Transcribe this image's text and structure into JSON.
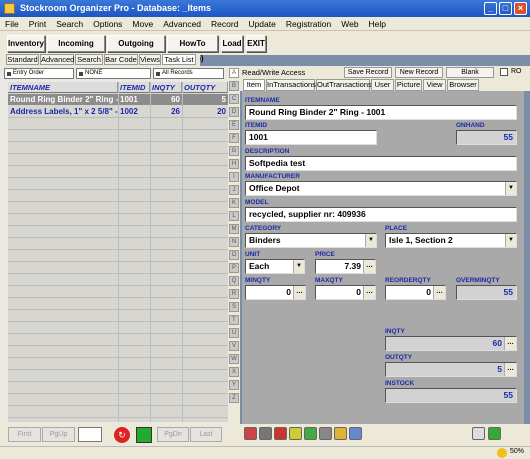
{
  "window": {
    "title": "Stockroom Organizer Pro - Database: _Items"
  },
  "menu": [
    "File",
    "Print",
    "Search",
    "Options",
    "Move",
    "Advanced",
    "Record",
    "Update",
    "Registration",
    "Web",
    "Help"
  ],
  "toolbar": {
    "inventory": "Inventory",
    "incoming": "Incoming Items",
    "outgoing": "Outgoing Items",
    "howto": "HowTo (Web)",
    "load": "Load",
    "exit": "EXIT"
  },
  "left_tabs": [
    "Standard",
    "Advanced",
    "Search",
    "Bar Code",
    "Views",
    "Task List"
  ],
  "filters": {
    "order": "Entry Order",
    "none": "NONE",
    "records": "All Records"
  },
  "grid": {
    "columns": [
      "ITEMNAME",
      "ITEMID",
      "INQTY",
      "OUTQTY"
    ],
    "rows": [
      {
        "name": "Round Ring Binder 2\" Ring - 1001",
        "id": "1001",
        "inqty": "60",
        "outqty": "5"
      },
      {
        "name": "Address Labels, 1\" x 2 5/8\" - 1002",
        "id": "1002",
        "inqty": "26",
        "outqty": "20"
      }
    ]
  },
  "alpha": [
    "A",
    "B",
    "C",
    "D",
    "E",
    "F",
    "G",
    "H",
    "I",
    "J",
    "K",
    "L",
    "M",
    "N",
    "O",
    "P",
    "Q",
    "R",
    "S",
    "T",
    "U",
    "V",
    "W",
    "X",
    "Y",
    "Z"
  ],
  "nav": {
    "first": "First",
    "pgup": "PgUp",
    "pgdn": "PgDn",
    "last": "Last"
  },
  "rw": {
    "label": "Read/Write Access",
    "save": "Save Record",
    "new": "New Record",
    "blank": "Blank",
    "ro": "RO"
  },
  "rtabs": [
    "Item",
    "InTransactions",
    "OutTransactions",
    "User",
    "Picture",
    "View",
    "Browser"
  ],
  "form": {
    "itemname_l": "ITEMNAME",
    "itemname": "Round Ring Binder 2\" Ring - 1001",
    "itemid_l": "ITEMID",
    "itemid": "1001",
    "onhand_l": "ONHAND",
    "onhand": "55",
    "desc_l": "DESCRIPTION",
    "desc": "Softpedia test",
    "manu_l": "MANUFACTURER",
    "manu": "Office Depot",
    "model_l": "MODEL",
    "model": "recycled, supplier nr: 409936",
    "cat_l": "CATEGORY",
    "cat": "Binders",
    "place_l": "PLACE",
    "place": "Isle 1, Section 2",
    "unit_l": "UNIT",
    "unit": "Each",
    "price_l": "PRICE",
    "price": "7.39",
    "minqty_l": "MINQTY",
    "minqty": "0",
    "maxqty_l": "MAXQTY",
    "maxqty": "0",
    "reorder_l": "REORDERQTY",
    "reorder": "0",
    "overmin_l": "OVERMINQTY",
    "overmin": "55",
    "inqty_l": "INQTY",
    "inqty": "60",
    "outqty_l": "OUTQTY",
    "outqty": "5",
    "instock_l": "INSTOCK",
    "instock": "55"
  },
  "status": {
    "zoom": "50%"
  }
}
